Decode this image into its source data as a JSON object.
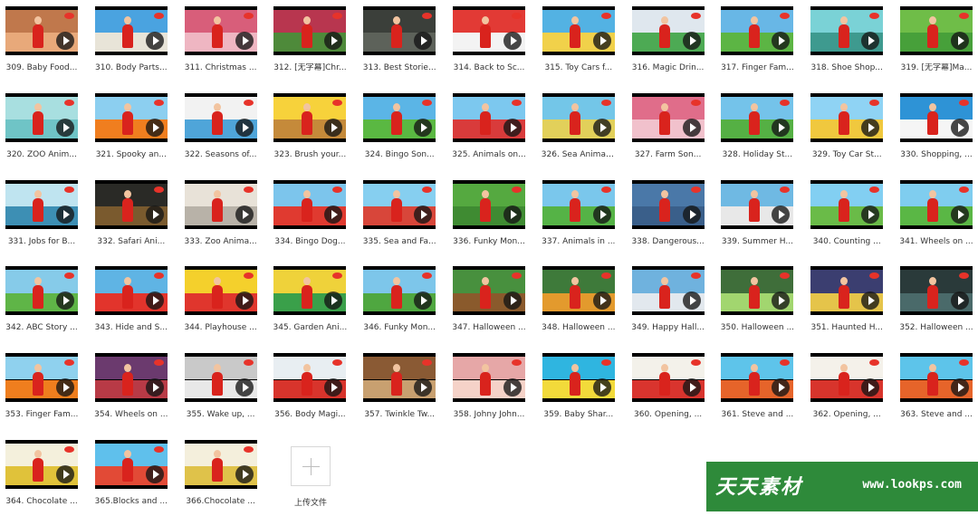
{
  "items": [
    {
      "label": "309. Baby Food...",
      "colors": [
        "#c0784c",
        "#e8a97a"
      ]
    },
    {
      "label": "310. Body Parts...",
      "colors": [
        "#4aa3e0",
        "#e8e4d8"
      ]
    },
    {
      "label": "311. Christmas ...",
      "colors": [
        "#d85e7a",
        "#efb6c2"
      ]
    },
    {
      "label": "312. [无字幕]Chr...",
      "colors": [
        "#b8364f",
        "#4e8a3a"
      ]
    },
    {
      "label": "313. Best Storie...",
      "colors": [
        "#3b3f3a",
        "#5d625a"
      ]
    },
    {
      "label": "314. Back to Sc...",
      "colors": [
        "#e23a35",
        "#f3f3f3"
      ]
    },
    {
      "label": "315. Toy Cars f...",
      "colors": [
        "#53b2e3",
        "#f1d14a"
      ]
    },
    {
      "label": "316. Magic Drin...",
      "colors": [
        "#dfe7ee",
        "#4daa54"
      ]
    },
    {
      "label": "317. Finger Fam...",
      "colors": [
        "#68b7e6",
        "#5cb544"
      ]
    },
    {
      "label": "318. Shoe Shop...",
      "colors": [
        "#7ad2d6",
        "#3e9a8f"
      ]
    },
    {
      "label": "319. [无字幕]Ma...",
      "colors": [
        "#6fbd48",
        "#47a03a"
      ]
    },
    {
      "label": "320. ZOO Anim...",
      "colors": [
        "#a8dfe0",
        "#6fc4c6"
      ]
    },
    {
      "label": "321. Spooky an...",
      "colors": [
        "#8ccff0",
        "#f07e1f"
      ]
    },
    {
      "label": "322. Seasons of...",
      "colors": [
        "#f2f2f2",
        "#4fa5d9"
      ]
    },
    {
      "label": "323. Brush your...",
      "colors": [
        "#f7d23b",
        "#c58a3a"
      ]
    },
    {
      "label": "324. Bingo Son...",
      "colors": [
        "#5bb5e6",
        "#5ab842"
      ]
    },
    {
      "label": "325. Animals on...",
      "colors": [
        "#7cc8ef",
        "#d93b3b"
      ]
    },
    {
      "label": "326. Sea Animal...",
      "colors": [
        "#73c6e8",
        "#e2d05a"
      ]
    },
    {
      "label": "327. Farm Son...",
      "colors": [
        "#e06d8a",
        "#f1c1cc"
      ]
    },
    {
      "label": "328. Holiday St...",
      "colors": [
        "#74c3ea",
        "#55b044"
      ]
    },
    {
      "label": "329. Toy Car St...",
      "colors": [
        "#8fd3f4",
        "#f0c83e"
      ]
    },
    {
      "label": "330. Shopping, ...",
      "colors": [
        "#2e93d6",
        "#f5f5f5"
      ]
    },
    {
      "label": "331. Jobs for B...",
      "colors": [
        "#bfe4f0",
        "#3d8fb4"
      ]
    },
    {
      "label": "332. Safari Ani...",
      "colors": [
        "#2a2a26",
        "#7a5a2e"
      ]
    },
    {
      "label": "333. Zoo Anima...",
      "colors": [
        "#e8e2d8",
        "#b8b2a8"
      ]
    },
    {
      "label": "334. Bingo Dog...",
      "colors": [
        "#7cc5ec",
        "#e03a30"
      ]
    },
    {
      "label": "335. Sea and Fa...",
      "colors": [
        "#86cff0",
        "#d8463a"
      ]
    },
    {
      "label": "336. Funky Mon...",
      "colors": [
        "#55a940",
        "#3f8b32"
      ]
    },
    {
      "label": "337. Animals in ...",
      "colors": [
        "#7ac7ec",
        "#55b346"
      ]
    },
    {
      "label": "338. Dangerous...",
      "colors": [
        "#4a78a8",
        "#3a5f8a"
      ]
    },
    {
      "label": "339. Summer H...",
      "colors": [
        "#6fb9e3",
        "#e8e8e8"
      ]
    },
    {
      "label": "340. Counting ...",
      "colors": [
        "#82cff2",
        "#6abb48"
      ]
    },
    {
      "label": "341. Wheels on ...",
      "colors": [
        "#7fcdef",
        "#5ab745"
      ]
    },
    {
      "label": "342. ABC Story ...",
      "colors": [
        "#86cbe9",
        "#5fb547"
      ]
    },
    {
      "label": "343. Hide and S...",
      "colors": [
        "#5fb4e4",
        "#e2342c"
      ]
    },
    {
      "label": "344. Playhouse ...",
      "colors": [
        "#f4d02c",
        "#e0362d"
      ]
    },
    {
      "label": "345. Garden Ani...",
      "colors": [
        "#efd23a",
        "#3aa04a"
      ]
    },
    {
      "label": "346. Funky Mon...",
      "colors": [
        "#7dc6ea",
        "#4fa740"
      ]
    },
    {
      "label": "347. Halloween ...",
      "colors": [
        "#48903e",
        "#8a5a2c"
      ]
    },
    {
      "label": "348. Halloween ...",
      "colors": [
        "#3e7a3a",
        "#e39a2d"
      ]
    },
    {
      "label": "349. Happy Hall...",
      "colors": [
        "#6fb2de",
        "#e2e8ee"
      ]
    },
    {
      "label": "350. Halloween ...",
      "colors": [
        "#3f6e3a",
        "#a2d66f"
      ]
    },
    {
      "label": "351. Haunted H...",
      "colors": [
        "#3b3e70",
        "#e5c44a"
      ]
    },
    {
      "label": "352. Halloween ...",
      "colors": [
        "#2a3a3a",
        "#4a6a6a"
      ]
    },
    {
      "label": "353. Finger Fam...",
      "colors": [
        "#8fd1ee",
        "#ef7e1e"
      ]
    },
    {
      "label": "354. Wheels on ...",
      "colors": [
        "#6b3a6e",
        "#b83a46"
      ]
    },
    {
      "label": "355. Wake up, ...",
      "colors": [
        "#c9c9c9",
        "#e8e8e8"
      ]
    },
    {
      "label": "356. Body Magi...",
      "colors": [
        "#e8eef2",
        "#d8342c"
      ]
    },
    {
      "label": "357. Twinkle Tw...",
      "colors": [
        "#8a5a34",
        "#c8a070"
      ]
    },
    {
      "label": "358. Johny John...",
      "colors": [
        "#e6a7a7",
        "#f5d2c8"
      ]
    },
    {
      "label": "359. Baby Shar...",
      "colors": [
        "#2fb5e0",
        "#f2da3a"
      ]
    },
    {
      "label": "360. Opening, ...",
      "colors": [
        "#f3f1ea",
        "#d9342e"
      ]
    },
    {
      "label": "361. Steve and ...",
      "colors": [
        "#5ec4ea",
        "#e6642a"
      ]
    },
    {
      "label": "362. Opening, ...",
      "colors": [
        "#f4f1ea",
        "#d8342c"
      ]
    },
    {
      "label": "363. Steve and ...",
      "colors": [
        "#5dc4ea",
        "#e6642a"
      ]
    },
    {
      "label": "364. Chocolate ...",
      "colors": [
        "#f4f0dc",
        "#e0c23a"
      ]
    },
    {
      "label": "365.Blocks and ...",
      "colors": [
        "#5fc0ec",
        "#e24a36"
      ]
    },
    {
      "label": "366.Chocolate ...",
      "colors": [
        "#f4efdc",
        "#dfc24a"
      ]
    }
  ],
  "upload": {
    "label": "上传文件"
  },
  "watermark": {
    "logo": "天天素材",
    "url": "www.lookps.com",
    "color": "#2e8a3a"
  }
}
